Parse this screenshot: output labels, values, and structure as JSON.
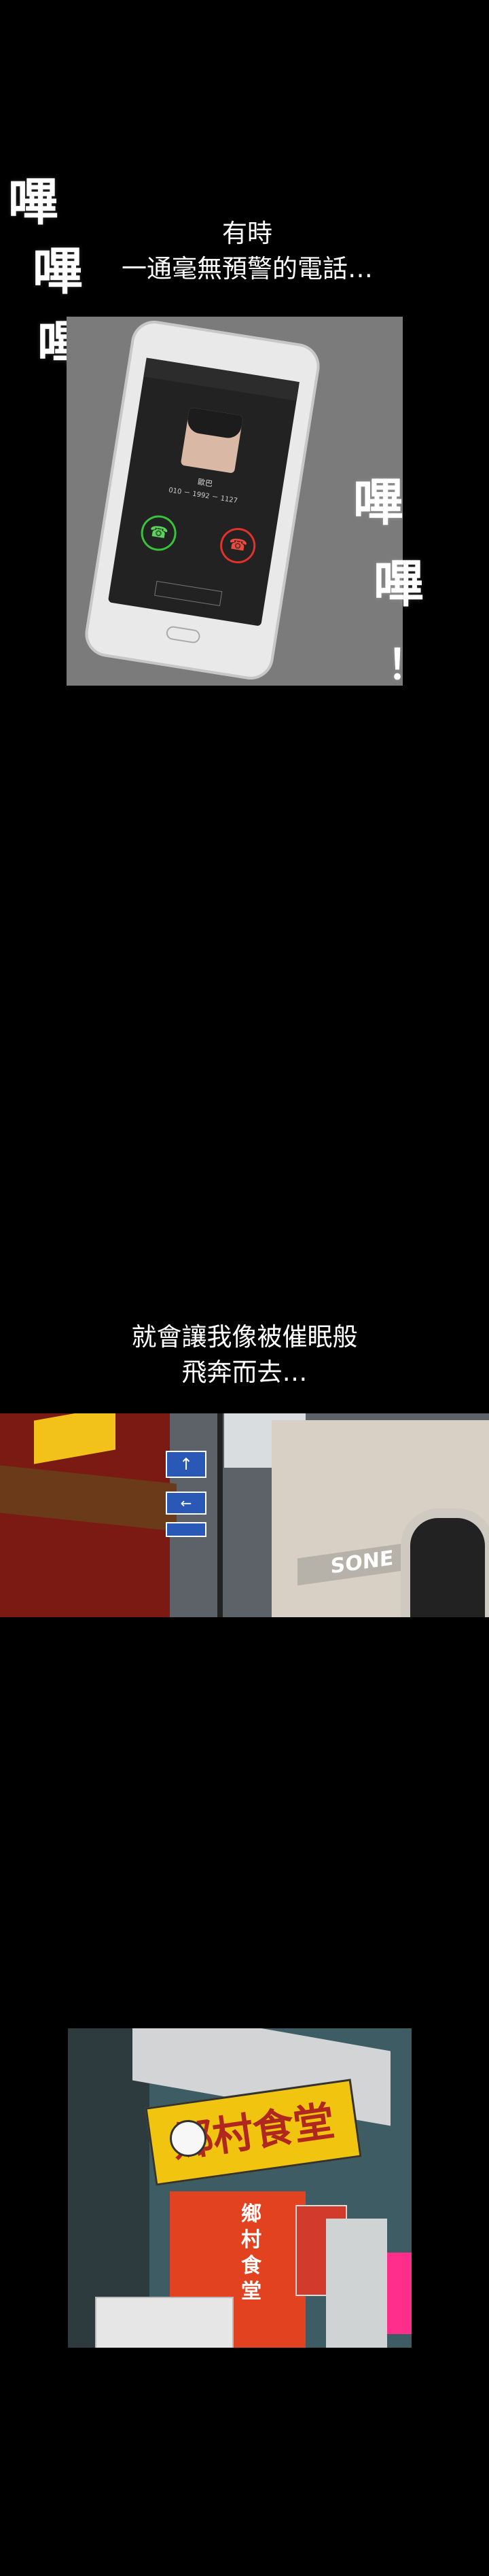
{
  "sfx_left": [
    "嗶",
    "嗶",
    "嗶"
  ],
  "sfx_right": [
    "嗶",
    "嗶",
    "！"
  ],
  "caption_1": [
    "有時",
    "一通毫無預警的電話…"
  ],
  "caption_2": [
    "就會讓我像被催眠般",
    "飛奔而去…"
  ],
  "phone": {
    "status": "",
    "incoming_label": "",
    "caller_name": "歐巴",
    "caller_number": "010 － 1992 － 1127",
    "answer_icon": "phone-answer-icon",
    "decline_icon": "phone-decline-icon",
    "bottom_button": ""
  },
  "street": {
    "building_sign": "SONE",
    "arrow_up": "↑",
    "arrow_left": "←"
  },
  "restaurant": {
    "sign": "鄉村食堂",
    "side_text": "鄉村食堂"
  },
  "colors": {
    "background": "#000000",
    "caption_text": "#ffffff",
    "answer_green": "#39c33c",
    "decline_red": "#e2322a",
    "restaurant_sign_yellow": "#f1c40f",
    "restaurant_door_red": "#e2421f"
  }
}
